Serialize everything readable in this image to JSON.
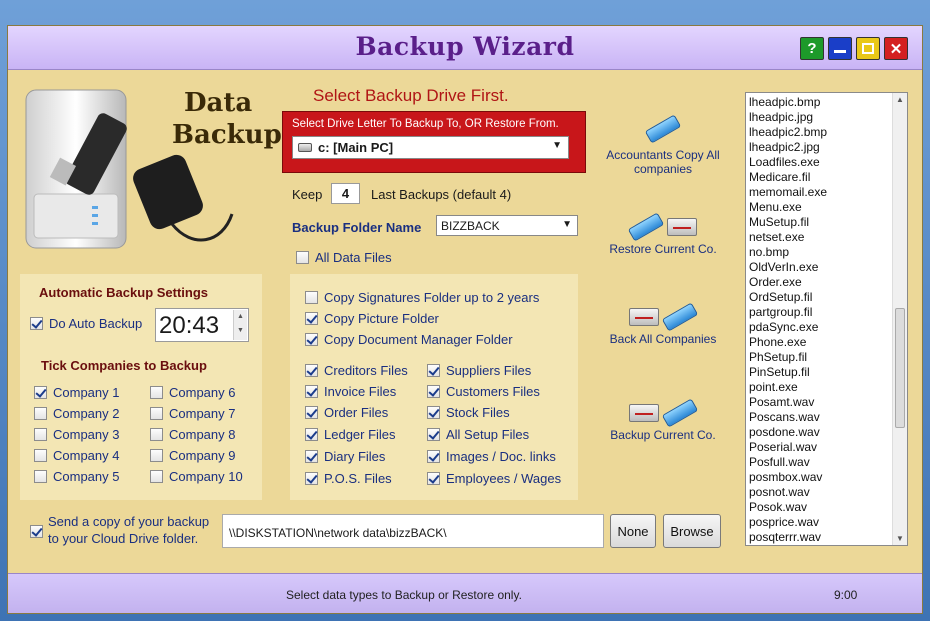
{
  "window": {
    "title": "Backup Wizard"
  },
  "titlebar_buttons": {
    "help": "?"
  },
  "hero": {
    "line1": "Data",
    "line2": "Backup"
  },
  "drive": {
    "heading": "Select Backup Drive First.",
    "instruction": "Select Drive Letter To Backup To, OR  Restore From.",
    "selected": "c: [Main PC]"
  },
  "keep": {
    "label": "Keep",
    "value": "4",
    "suffix": "Last Backups (default 4)"
  },
  "folder": {
    "label": "Backup Folder Name",
    "value": "BIZZBACK"
  },
  "all_data_files": {
    "label": "All  Data Files",
    "checked": false
  },
  "auto_backup": {
    "heading": "Automatic Backup Settings",
    "do_auto_label": "Do Auto Backup",
    "do_auto_checked": true,
    "time": "20:43",
    "companies_heading": "Tick Companies to Backup",
    "companies": [
      {
        "label": "Company 1",
        "checked": true
      },
      {
        "label": "Company 2",
        "checked": false
      },
      {
        "label": "Company 3",
        "checked": false
      },
      {
        "label": "Company 4",
        "checked": false
      },
      {
        "label": "Company 5",
        "checked": false
      },
      {
        "label": "Company 6",
        "checked": false
      },
      {
        "label": "Company 7",
        "checked": false
      },
      {
        "label": "Company 8",
        "checked": false
      },
      {
        "label": "Company 9",
        "checked": false
      },
      {
        "label": "Company 10",
        "checked": false
      }
    ]
  },
  "options": {
    "folders": [
      {
        "label": "Copy Signatures Folder up to 2 years",
        "checked": false
      },
      {
        "label": "Copy Picture Folder",
        "checked": true
      },
      {
        "label": "Copy Document Manager Folder",
        "checked": true
      }
    ],
    "files_left": [
      {
        "label": "Creditors Files",
        "checked": true
      },
      {
        "label": "Invoice Files",
        "checked": true
      },
      {
        "label": "Order Files",
        "checked": true
      },
      {
        "label": "Ledger Files",
        "checked": true
      },
      {
        "label": "Diary Files",
        "checked": true
      },
      {
        "label": "P.O.S. Files",
        "checked": true
      }
    ],
    "files_right": [
      {
        "label": "Suppliers Files",
        "checked": true
      },
      {
        "label": "Customers Files",
        "checked": true
      },
      {
        "label": "Stock Files",
        "checked": true
      },
      {
        "label": "All Setup Files",
        "checked": true
      },
      {
        "label": "Images / Doc. links",
        "checked": true
      },
      {
        "label": "Employees / Wages",
        "checked": true
      }
    ]
  },
  "actions": {
    "accountants_copy": "Accountants Copy All companies",
    "restore_current": "Restore Current Co.",
    "backup_all": "Back All Companies",
    "backup_current": "Backup Current Co."
  },
  "cloud": {
    "checked": true,
    "line1": "Send a copy of your backup",
    "line2": "to your Cloud Drive folder.",
    "path": "\\\\DISKSTATION\\network data\\bizzBACK\\",
    "none_label": "None",
    "browse_label": "Browse"
  },
  "files": [
    "lheadpic.bmp",
    "lheadpic.jpg",
    "lheadpic2.bmp",
    "lheadpic2.jpg",
    "Loadfiles.exe",
    "Medicare.fil",
    "memomail.exe",
    "Menu.exe",
    "MuSetup.fil",
    "netset.exe",
    "no.bmp",
    "OldVerIn.exe",
    "Order.exe",
    "OrdSetup.fil",
    "partgroup.fil",
    "pdaSync.exe",
    "Phone.exe",
    "PhSetup.fil",
    "PinSetup.fil",
    "point.exe",
    "Posamt.wav",
    "Poscans.wav",
    "posdone.wav",
    "Poserial.wav",
    "Posfull.wav",
    "posmbox.wav",
    "posnot.wav",
    "Posok.wav",
    "posprice.wav",
    "posqterrr.wav"
  ],
  "status": {
    "message": "Select data types to Backup or Restore only.",
    "time": "9:00"
  }
}
